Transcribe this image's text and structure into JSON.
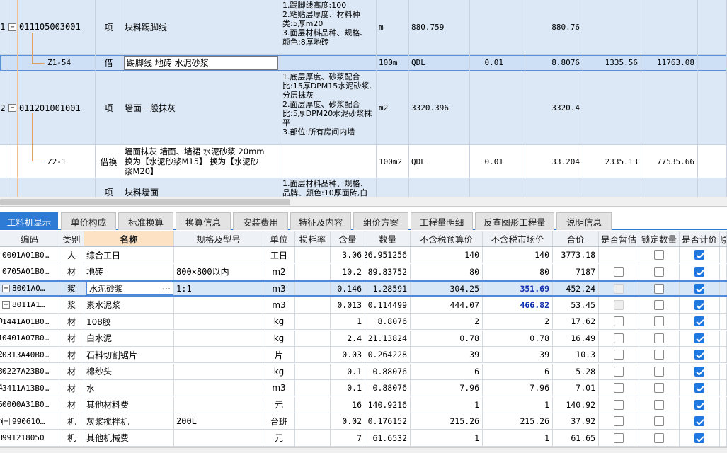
{
  "upper": {
    "rows": [
      {
        "idx": "1",
        "code": "011105003001",
        "type": "项",
        "name": "块料踢脚线",
        "feature": [
          "1.踢脚线高度:100",
          "2.粘贴层厚度、材料种",
          "类:5厚m20",
          "3.面层材料品种、规格、",
          "颜色:8厚地砖"
        ],
        "unit": "m",
        "qty_expr": "880.759",
        "content_qty": "",
        "qty": "880.76",
        "price": "",
        "total": ""
      },
      {
        "idx": "",
        "code": "Z1-54",
        "type": "借",
        "name": "踢脚线 地砖 水泥砂浆",
        "feature": [],
        "unit": "100m",
        "qty_expr": "QDL",
        "content_qty": "0.01",
        "qty": "8.8076",
        "price": "1335.56",
        "total": "11763.08"
      },
      {
        "idx": "2",
        "code": "011201001001",
        "type": "项",
        "name": "墙面一般抹灰",
        "feature": [
          "1.底层厚度、砂浆配合",
          "比:15厚DPM15水泥砂浆,",
          "分层抹灰",
          "2.面层厚度、砂浆配合",
          "比:5厚DPM20水泥砂浆抹",
          "平",
          "3.部位:所有房间内墙"
        ],
        "unit": "m2",
        "qty_expr": "3320.396",
        "content_qty": "",
        "qty": "3320.4",
        "price": "",
        "total": ""
      },
      {
        "idx": "",
        "code": "Z2-1",
        "type": "借换",
        "name_lines": [
          "墙面抹灰 墙面、墙裙 水泥砂浆 20mm",
          "换为【水泥砂浆M15】  换为【水泥砂",
          "浆M20】"
        ],
        "feature": [],
        "unit": "100m2",
        "qty_expr": "QDL",
        "content_qty": "0.01",
        "qty": "33.204",
        "price": "2335.13",
        "total": "77535.66"
      },
      {
        "idx": "",
        "code": "",
        "type": "项",
        "name": "块料墙面",
        "feature": [
          "1.面层材料品种、规格、",
          "品牌、颜色:10厚面砖,白"
        ],
        "unit": "",
        "qty_expr": "",
        "content_qty": "",
        "qty": "",
        "price": "",
        "total": ""
      }
    ]
  },
  "tabs": [
    "工料机显示",
    "单价构成",
    "标准换算",
    "换算信息",
    "安装费用",
    "特征及内容",
    "组价方案",
    "工程量明细",
    "反查图形工程量",
    "说明信息"
  ],
  "active_tab": "工料机显示",
  "lower": {
    "headers": [
      "编码",
      "类别",
      "名称",
      "规格及型号",
      "单位",
      "损耗率",
      "含量",
      "数量",
      "不含税预算价",
      "不含税市场价",
      "合价",
      "是否暂估",
      "锁定数量",
      "是否计价",
      "原"
    ],
    "rows": [
      {
        "rn": "",
        "code": "0001A01B0…",
        "cat": "人",
        "name": "综合工日",
        "spec": "",
        "unit": "工日",
        "loss": "",
        "content": "3.06",
        "qty": "26.951256",
        "budget": "140",
        "market": "140",
        "total": "3773.18",
        "est": "none",
        "lock": "empty",
        "price": "checked",
        "plus": false,
        "blue": false
      },
      {
        "rn": "",
        "code": "0705A01B0…",
        "cat": "材",
        "name": "地砖",
        "spec": "800×800以内",
        "unit": "m2",
        "loss": "",
        "content": "10.2",
        "qty": "89.83752",
        "budget": "80",
        "market": "80",
        "total": "7187",
        "est": "empty",
        "lock": "empty",
        "price": "checked",
        "plus": false,
        "blue": false
      },
      {
        "rn": "",
        "code": "8001A0…",
        "cat": "浆",
        "name": "水泥砂浆",
        "spec": "1:1",
        "unit": "m3",
        "loss": "",
        "content": "0.146",
        "qty": "1.28591",
        "budget": "304.25",
        "market": "351.69",
        "total": "452.24",
        "est": "disabled",
        "lock": "empty",
        "price": "checked",
        "plus": true,
        "blue": true,
        "selected": true
      },
      {
        "rn": "",
        "code": "8011A1…",
        "cat": "浆",
        "name": "素水泥浆",
        "spec": "",
        "unit": "m3",
        "loss": "",
        "content": "0.013",
        "qty": "0.114499",
        "budget": "444.07",
        "market": "466.82",
        "total": "53.45",
        "est": "disabled",
        "lock": "empty",
        "price": "checked",
        "plus": true,
        "blue": true
      },
      {
        "rn": "0",
        "code": "1441A01B0…",
        "cat": "材",
        "name": "108胶",
        "spec": "",
        "unit": "kg",
        "loss": "",
        "content": "1",
        "qty": "8.8076",
        "budget": "2",
        "market": "2",
        "total": "17.62",
        "est": "empty",
        "lock": "empty",
        "price": "checked",
        "plus": false,
        "blue": false
      },
      {
        "rn": "1",
        "code": "0401A07B0…",
        "cat": "材",
        "name": "白水泥",
        "spec": "",
        "unit": "kg",
        "loss": "",
        "content": "2.4",
        "qty": "21.13824",
        "budget": "0.78",
        "market": "0.78",
        "total": "16.49",
        "est": "empty",
        "lock": "empty",
        "price": "checked",
        "plus": false,
        "blue": false
      },
      {
        "rn": "2",
        "code": "0313A40B0…",
        "cat": "材",
        "name": "石料切割锯片",
        "spec": "",
        "unit": "片",
        "loss": "",
        "content": "0.03",
        "qty": "0.264228",
        "budget": "39",
        "market": "39",
        "total": "10.3",
        "est": "empty",
        "lock": "empty",
        "price": "checked",
        "plus": false,
        "blue": false
      },
      {
        "rn": "3",
        "code": "0227A23B0…",
        "cat": "材",
        "name": "棉纱头",
        "spec": "",
        "unit": "kg",
        "loss": "",
        "content": "0.1",
        "qty": "0.88076",
        "budget": "6",
        "market": "6",
        "total": "5.28",
        "est": "empty",
        "lock": "empty",
        "price": "checked",
        "plus": false,
        "blue": false
      },
      {
        "rn": "4",
        "code": "3411A13B0…",
        "cat": "材",
        "name": "水",
        "spec": "",
        "unit": "m3",
        "loss": "",
        "content": "0.1",
        "qty": "0.88076",
        "budget": "7.96",
        "market": "7.96",
        "total": "7.01",
        "est": "empty",
        "lock": "empty",
        "price": "checked",
        "plus": false,
        "blue": false
      },
      {
        "rn": "5",
        "code": "0000A31B0…",
        "cat": "材",
        "name": "其他材料费",
        "spec": "",
        "unit": "元",
        "loss": "",
        "content": "16",
        "qty": "140.9216",
        "budget": "1",
        "market": "1",
        "total": "140.92",
        "est": "empty",
        "lock": "empty",
        "price": "checked",
        "plus": false,
        "blue": false
      },
      {
        "rn": "6",
        "code": "990610…",
        "cat": "机",
        "name": "灰浆搅拌机",
        "spec": "200L",
        "unit": "台班",
        "loss": "",
        "content": "0.02",
        "qty": "0.176152",
        "budget": "215.26",
        "market": "215.26",
        "total": "37.92",
        "est": "empty",
        "lock": "empty",
        "price": "checked",
        "plus": true,
        "blue": false
      },
      {
        "rn": "8",
        "code": "991218050",
        "cat": "机",
        "name": "其他机械费",
        "spec": "",
        "unit": "元",
        "loss": "",
        "content": "7",
        "qty": "61.6532",
        "budget": "1",
        "market": "1",
        "total": "61.65",
        "est": "empty",
        "lock": "empty",
        "price": "checked",
        "plus": false,
        "blue": false
      }
    ]
  },
  "colors": {
    "accent": "#2e7bd6",
    "item_row": "#dce8f6",
    "name_header": "#fde3c4",
    "market_price_blue": "#1030b0"
  }
}
